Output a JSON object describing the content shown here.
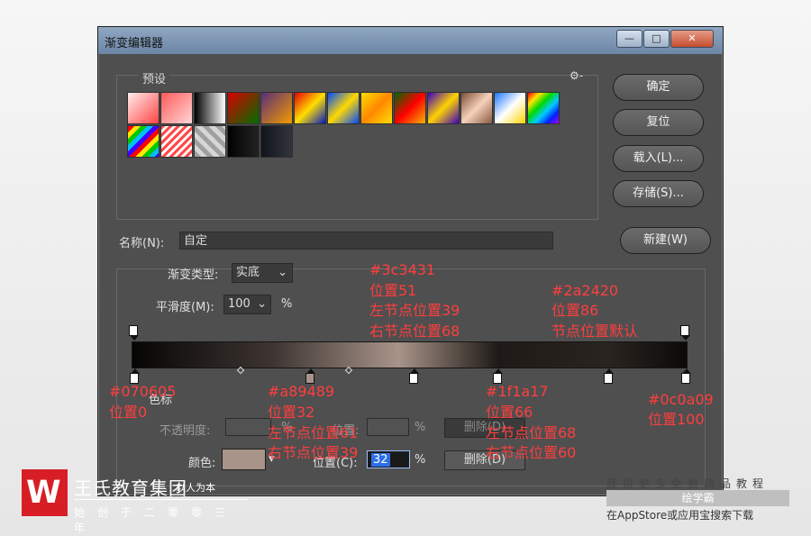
{
  "window": {
    "title": "渐变编辑器",
    "controls": [
      "—",
      "□",
      "✕"
    ]
  },
  "presets": {
    "label": "预设",
    "gear_symbol": "⚙-",
    "swatches": [
      {
        "css": "linear-gradient(135deg,#ffeded,#f44)"
      },
      {
        "css": "linear-gradient(135deg,#ff5a5a,#ffd6d6)"
      },
      {
        "css": "linear-gradient(90deg,#000,#fff)"
      },
      {
        "css": "linear-gradient(135deg,#d80000,#006f00)"
      },
      {
        "css": "linear-gradient(135deg,#5a2f77,#f39b00)"
      },
      {
        "css": "linear-gradient(135deg,#e30000,#ffde00,#0018c8)"
      },
      {
        "css": "linear-gradient(135deg,#0048ff,#ffd900,#0048ff)"
      },
      {
        "css": "linear-gradient(135deg,#ffdf00,#ff8800,#ffdf00)"
      },
      {
        "css": "linear-gradient(135deg,#006600,#ff0000,#f5b400)"
      },
      {
        "css": "linear-gradient(135deg,#3b00bf,#ffd300,#3b00bf)"
      },
      {
        "css": "linear-gradient(135deg,#7b4d33,#f6d1bb,#8a5a40)"
      },
      {
        "css": "linear-gradient(135deg,#1a74ff,#fff,#ffd400)"
      },
      {
        "css": "linear-gradient(135deg,#ff0000,#ffe600,#00d900,#00ccff,#0020ff,#b400ff)"
      },
      {
        "css": "repeating-linear-gradient(135deg,#ff0000 0 5px,#ffe600 5px 10px,#00c800 10px 15px,#00bfff 15px 20px,#4000ff 20px 25px)"
      },
      {
        "css": "repeating-linear-gradient(135deg,#ff4a4a 0 3px,#fff 3px 6px)"
      },
      {
        "css": "repeating-linear-gradient(45deg,#a0a0a0 0 5px,#d6d6d6 5px 10px)"
      },
      {
        "css": "linear-gradient(90deg,#020202,#222)"
      },
      {
        "css": "linear-gradient(90deg,#12141e,#31343b)"
      }
    ]
  },
  "buttons": {
    "ok": "确定",
    "reset": "复位",
    "load": "载入(L)...",
    "save": "存储(S)...",
    "new": "新建(W)"
  },
  "name": {
    "label": "名称(N):",
    "value": "自定"
  },
  "gradient": {
    "type_label": "渐变类型:",
    "type_value": "实底",
    "smooth_label": "平滑度(M):",
    "smooth_value": "100",
    "percent": "%"
  },
  "stops": {
    "section_label": "色标",
    "opacity_label": "不透明度:",
    "opacity_percent": "%",
    "opacity_location_label": "位置:",
    "opacity_location_percent": "%",
    "opacity_delete": "删除(D)",
    "color_label": "颜色:",
    "color_value": "#a89489",
    "location_label": "位置(C):",
    "location_value": "32",
    "location_percent": "%",
    "delete": "删除(D)"
  },
  "annotations": {
    "a1": "#070605",
    "a1b": "位置0",
    "a2": "#a89489",
    "a2b": "位置32",
    "a2c": "左节点位置61",
    "a2d": "右节点位置39",
    "a3": "#3c3431",
    "a3b": "位置51",
    "a3c": "左节点位置39",
    "a3d": "右节点位置68",
    "a4": "#2a2420",
    "a4b": "位置86",
    "a4c": "节点位置默认",
    "a5": "#1f1a17",
    "a5b": "位置66",
    "a5c": "左节点位置68",
    "a5d": "右节点位置60",
    "a6": "#0c0a09",
    "a6b": "位置100"
  },
  "watermark": {
    "brand": "王氏教育集团",
    "motto": "以人为本",
    "slogan": "始创于二零零三年",
    "right_top": "获得更多免费精品教程",
    "right_band": "绘学霸",
    "right_bottom": "在AppStore或应用宝搜索下载"
  }
}
